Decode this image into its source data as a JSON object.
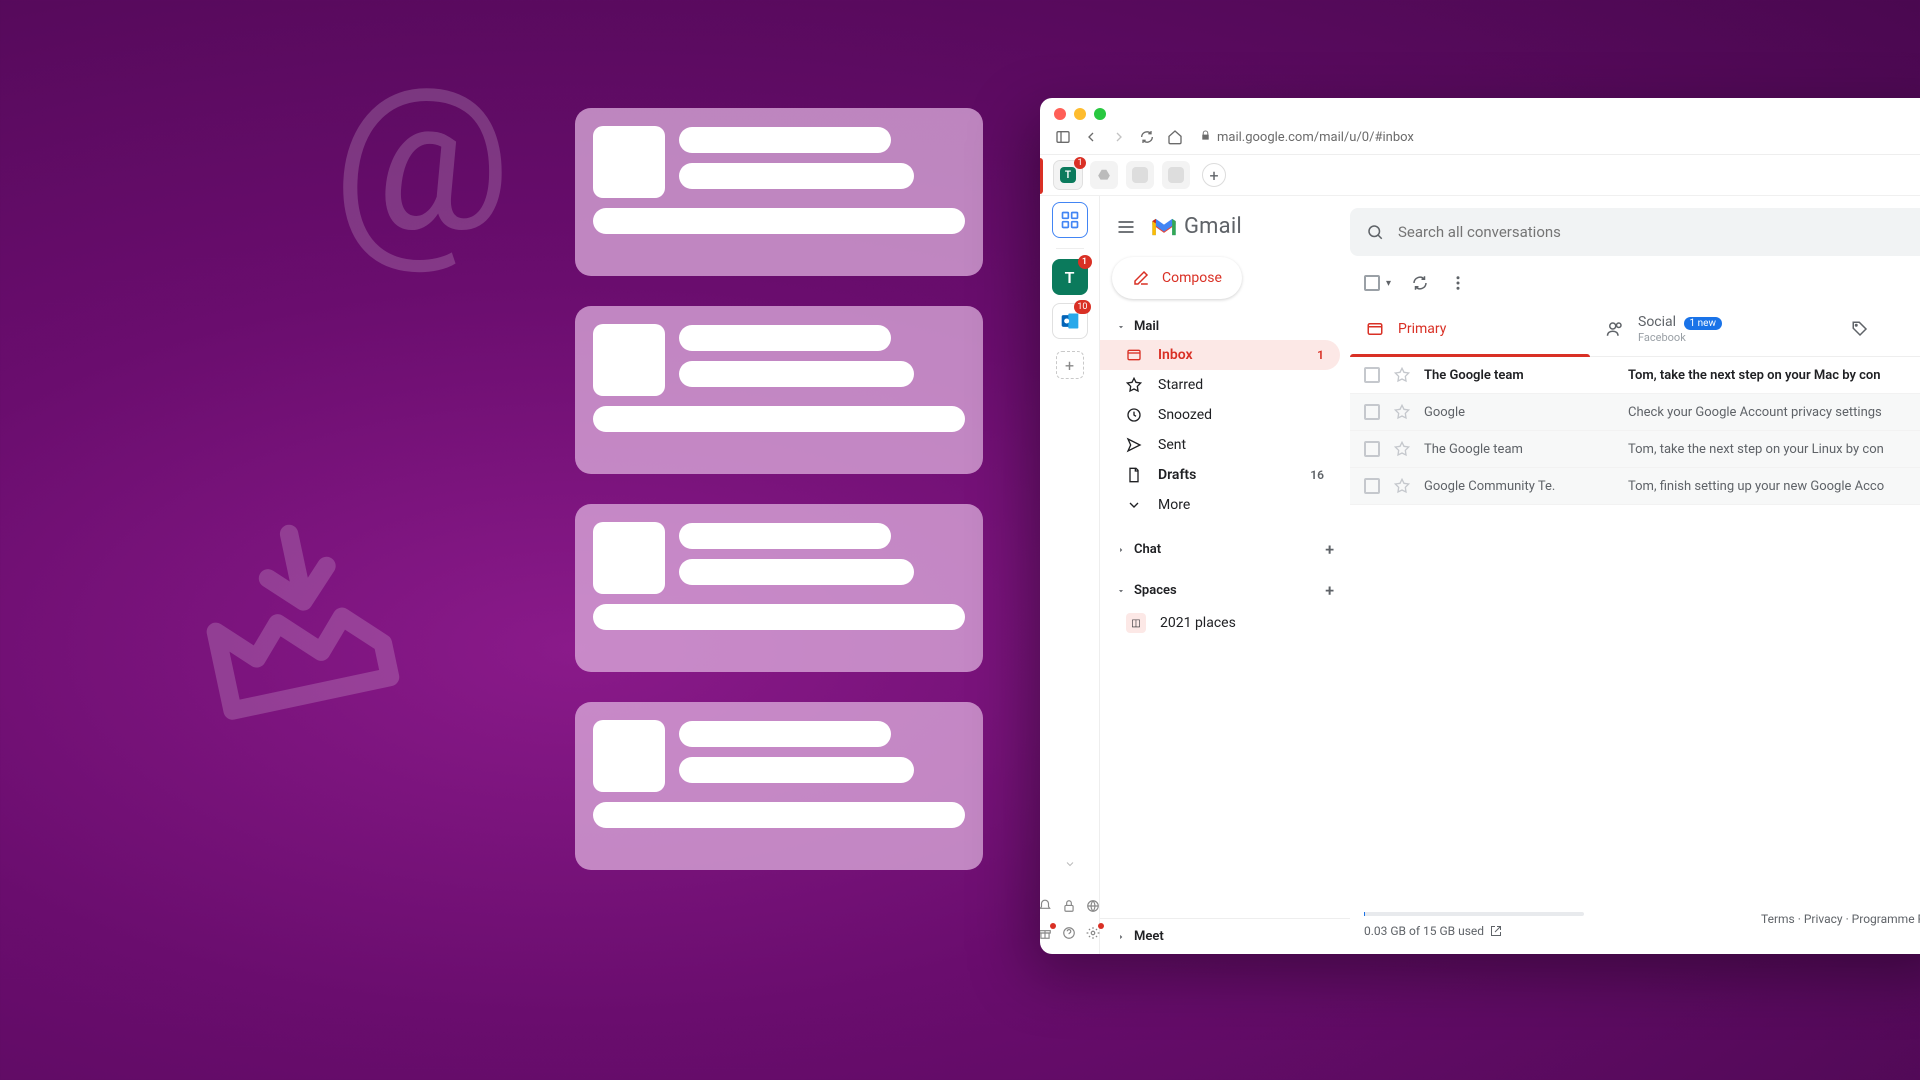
{
  "browser": {
    "url": "mail.google.com/mail/u/0/#inbox",
    "tabstrip": {
      "account_letter": "T",
      "account_badge": "1"
    }
  },
  "rail": {
    "account_letter": "T",
    "account_badge": "1",
    "outlook_badge": "10"
  },
  "gmail": {
    "brand": "Gmail",
    "compose": "Compose",
    "search_placeholder": "Search all conversations",
    "sections": {
      "mail": "Mail",
      "chat": "Chat",
      "spaces": "Spaces",
      "meet": "Meet"
    },
    "nav": {
      "inbox": {
        "label": "Inbox",
        "count": "1"
      },
      "starred": "Starred",
      "snoozed": "Snoozed",
      "sent": "Sent",
      "drafts": {
        "label": "Drafts",
        "count": "16"
      },
      "more": "More"
    },
    "spaces_items": {
      "places": "2021 places"
    },
    "tabs": {
      "primary": "Primary",
      "social": {
        "label": "Social",
        "pill": "1 new",
        "sub": "Facebook"
      }
    },
    "messages": [
      {
        "from": "The Google team",
        "subj": "Tom, take the next step on your Mac by con",
        "unread": true
      },
      {
        "from": "Google",
        "subj": "Check your Google Account privacy settings",
        "unread": false
      },
      {
        "from": "The Google team",
        "subj": "Tom, take the next step on your Linux by con",
        "unread": false
      },
      {
        "from": "Google Community Te.",
        "subj": "Tom, finish setting up your new Google Acco",
        "unread": false
      }
    ],
    "footer": {
      "storage": "0.03 GB of 15 GB used",
      "links": "Terms · Privacy · Programme Polic"
    }
  }
}
